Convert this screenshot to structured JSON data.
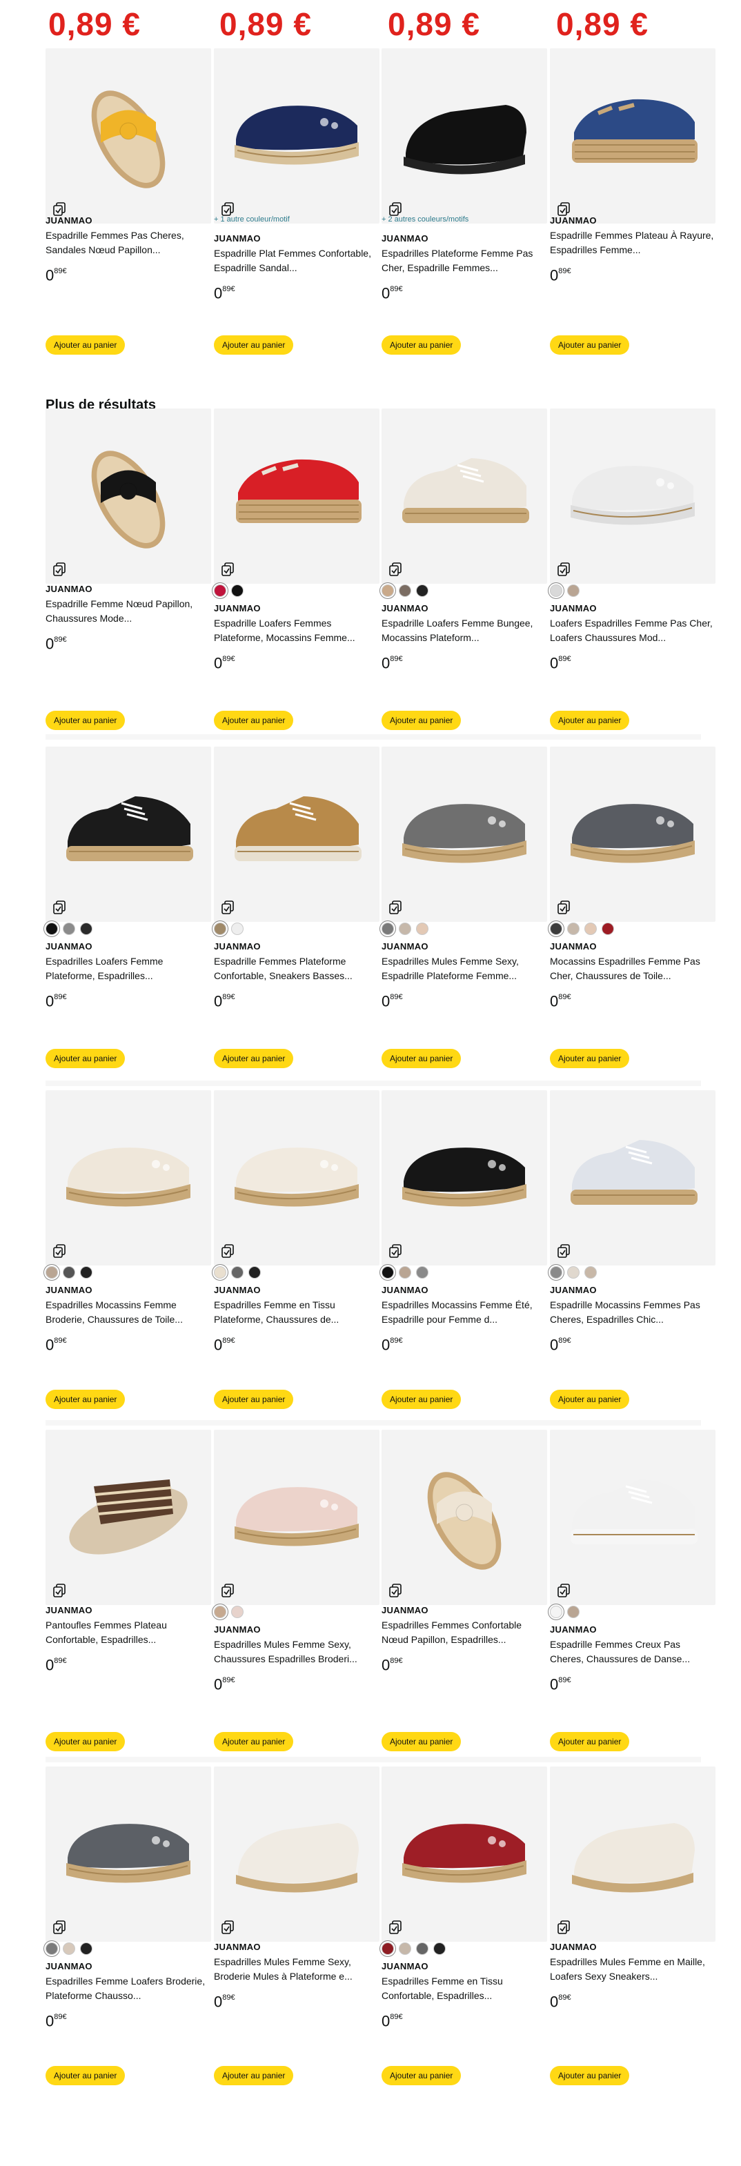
{
  "top_prices": [
    "0,89 €",
    "0,89 €",
    "0,89 €",
    "0,89 €"
  ],
  "section_title": "Plus de résultats",
  "add_to_cart": "Ajouter au panier",
  "price": {
    "whole": "0",
    "fraction": "89",
    "currency": "€"
  },
  "products": [
    {
      "brand": "JUANMAO",
      "title": "Espadrille Femmes Pas Cheres, Sandales Nœud Papillon...",
      "more": "",
      "swatches": [],
      "shoe": "slide-bow",
      "colors": [
        "#f0b428",
        "#d8b484"
      ]
    },
    {
      "brand": "JUANMAO",
      "title": "Espadrille Plat Femmes Confortable, Espadrille Sandal...",
      "more": "+ 1 autre couleur/motif",
      "swatches": [],
      "shoe": "slipon",
      "colors": [
        "#1c2a5c",
        "#d7c19a"
      ]
    },
    {
      "brand": "JUANMAO",
      "title": "Espadrilles Plateforme Femme Pas Cher, Espadrille Femmes...",
      "more": "+ 2 autres couleurs/motifs",
      "swatches": [],
      "shoe": "mule",
      "colors": [
        "#111111",
        "#222222"
      ]
    },
    {
      "brand": "JUANMAO",
      "title": "Espadrille Femmes Plateau À Rayure, Espadrilles Femme...",
      "more": "",
      "swatches": [],
      "shoe": "platform",
      "colors": [
        "#2c4a86",
        "#c9a97a"
      ]
    },
    {
      "brand": "JUANMAO",
      "title": "Espadrille Femme Nœud Papillon, Chaussures Mode...",
      "more": "",
      "swatches": [],
      "shoe": "slide-bow",
      "colors": [
        "#151515",
        "#cfa877"
      ]
    },
    {
      "brand": "JUANMAO",
      "title": "Espadrille Loafers Femmes Plateforme, Mocassins Femme...",
      "more": "",
      "swatches": [
        "#c0143c",
        "#111111"
      ],
      "shoe": "platform",
      "colors": [
        "#d81f26",
        "#e9e2d6"
      ]
    },
    {
      "brand": "JUANMAO",
      "title": "Espadrille Loafers Femme Bungee, Mocassins Plateform...",
      "more": "",
      "swatches": [
        "#c9a98a",
        "#7b6d63",
        "#222222"
      ],
      "shoe": "sneaker",
      "colors": [
        "#ece6dc",
        "#c8a979"
      ]
    },
    {
      "brand": "JUANMAO",
      "title": "Loafers Espadrilles Femme Pas Cher, Loafers Chaussures Mod...",
      "more": "",
      "swatches": [
        "#d9d9d9",
        "#b9a593"
      ],
      "shoe": "flat",
      "colors": [
        "#ececec",
        "#dddddd"
      ]
    },
    {
      "brand": "JUANMAO",
      "title": "Espadrilles Loafers Femme Plateforme, Espadrilles...",
      "more": "",
      "swatches": [
        "#111111",
        "#8b8b8b",
        "#2b2b2b"
      ],
      "shoe": "sneaker",
      "colors": [
        "#1b1b1b",
        "#c8a979"
      ]
    },
    {
      "brand": "JUANMAO",
      "title": "Espadrille Femmes Plateforme Confortable, Sneakers Basses...",
      "more": "",
      "swatches": [
        "#a08a6a",
        "#eeeeee"
      ],
      "shoe": "sneaker",
      "colors": [
        "#b88a4a",
        "#e7dfcf"
      ]
    },
    {
      "brand": "JUANMAO",
      "title": "Espadrilles Mules Femme Sexy, Espadrille Plateforme Femme...",
      "more": "",
      "swatches": [
        "#7a7a7a",
        "#c6b8aa",
        "#e3c9b5"
      ],
      "shoe": "flat",
      "colors": [
        "#6f6f6f",
        "#c8a979"
      ]
    },
    {
      "brand": "JUANMAO",
      "title": "Mocassins Espadrilles Femme Pas Cher, Chaussures de Toile...",
      "more": "",
      "swatches": [
        "#3c3c3c",
        "#c6b8aa",
        "#e3c9b5",
        "#9d1c24"
      ],
      "shoe": "flat",
      "colors": [
        "#595c62",
        "#c8a979"
      ]
    },
    {
      "brand": "JUANMAO",
      "title": "Espadrilles Mocassins Femme Broderie, Chaussures de Toile...",
      "more": "",
      "swatches": [
        "#b9a593",
        "#555555",
        "#222222"
      ],
      "shoe": "flat",
      "colors": [
        "#efe7da",
        "#c8a979"
      ]
    },
    {
      "brand": "JUANMAO",
      "title": "Espadrilles Femme en Tissu Plateforme, Chaussures de...",
      "more": "",
      "swatches": [
        "#e9dfcf",
        "#666666",
        "#222222"
      ],
      "shoe": "flat",
      "colors": [
        "#f1eadf",
        "#c8a979"
      ]
    },
    {
      "brand": "JUANMAO",
      "title": "Espadrilles Mocassins Femme Été, Espadrille pour Femme d...",
      "more": "",
      "swatches": [
        "#111111",
        "#b9a593",
        "#8a8a8a"
      ],
      "shoe": "flat",
      "colors": [
        "#161616",
        "#c8a979"
      ]
    },
    {
      "brand": "JUANMAO",
      "title": "Espadrille Mocassins Femmes Pas Cheres, Espadrilles Chic...",
      "more": "",
      "swatches": [
        "#8a8a8a",
        "#e0d8ce",
        "#c8b8a8"
      ],
      "shoe": "sneaker",
      "colors": [
        "#dfe3ea",
        "#c8a979"
      ]
    },
    {
      "brand": "JUANMAO",
      "title": "Pantoufles Femmes Plateau Confortable, Espadrilles...",
      "more": "",
      "swatches": [],
      "shoe": "slide",
      "colors": [
        "#5a3d2b",
        "#d8c7ad"
      ]
    },
    {
      "brand": "JUANMAO",
      "title": "Espadrilles Mules Femme Sexy, Chaussures Espadrilles Broderi...",
      "more": "",
      "swatches": [
        "#c6a990",
        "#e7d3cc"
      ],
      "shoe": "flat",
      "colors": [
        "#ecd3cb",
        "#c8a979"
      ]
    },
    {
      "brand": "JUANMAO",
      "title": "Espadrilles Femmes Confortable Nœud Papillon, Espadrilles...",
      "more": "",
      "swatches": [],
      "shoe": "slide-bow",
      "colors": [
        "#eee4d4",
        "#cfa877"
      ]
    },
    {
      "brand": "JUANMAO",
      "title": "Espadrille Femmes Creux Pas Cheres, Chaussures de Danse...",
      "more": "",
      "swatches": [
        "#f4f4f4",
        "#b9a593"
      ],
      "shoe": "sneaker",
      "colors": [
        "#f2f2f2",
        "#f6f6f6"
      ]
    },
    {
      "brand": "JUANMAO",
      "title": "Espadrilles Femme Loafers Broderie, Plateforme Chausso...",
      "more": "",
      "swatches": [
        "#7b7b7b",
        "#d7c9bb",
        "#222222"
      ],
      "shoe": "flat",
      "colors": [
        "#5c6066",
        "#c8a979"
      ]
    },
    {
      "brand": "JUANMAO",
      "title": "Espadrilles Mules Femme Sexy, Broderie Mules à Plateforme e...",
      "more": "",
      "swatches": [],
      "shoe": "mule",
      "colors": [
        "#f0ebe3",
        "#c8a979"
      ]
    },
    {
      "brand": "JUANMAO",
      "title": "Espadrilles Femme en Tissu Confortable, Espadrilles...",
      "more": "",
      "swatches": [
        "#8e1d24",
        "#c6b8aa",
        "#666666",
        "#222222"
      ],
      "shoe": "flat",
      "colors": [
        "#9e1e26",
        "#c8a979"
      ]
    },
    {
      "brand": "JUANMAO",
      "title": "Espadrilles Mules Femme en Maille, Loafers Sexy Sneakers...",
      "more": "",
      "swatches": [],
      "shoe": "mule",
      "colors": [
        "#efe9df",
        "#c8a979"
      ]
    }
  ]
}
